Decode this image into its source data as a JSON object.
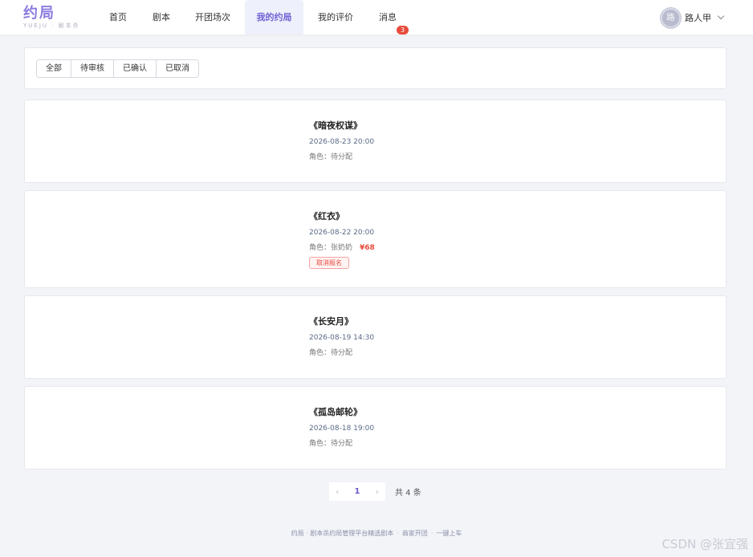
{
  "brand": {
    "name": "约局",
    "sub": "YUEJU · 剧本杀"
  },
  "nav": [
    {
      "label": "首页"
    },
    {
      "label": "剧本"
    },
    {
      "label": "开团场次"
    },
    {
      "label": "我的约局",
      "active": true
    },
    {
      "label": "我的评价"
    },
    {
      "label": "消息",
      "badge": "3"
    }
  ],
  "user": {
    "avatar_char": "路",
    "name": "路人甲"
  },
  "filters": [
    "全部",
    "待审核",
    "已确认",
    "已取消"
  ],
  "bookings": [
    {
      "title": "《暗夜权谋》",
      "time": "2026-08-23 20:00",
      "role": "角色：待分配"
    },
    {
      "title": "《红衣》",
      "time": "2026-08-22 20:00",
      "role": "角色：张奶奶",
      "price": "¥68",
      "action": "取消报名"
    },
    {
      "title": "《长安月》",
      "time": "2026-08-19 14:30",
      "role": "角色：待分配"
    },
    {
      "title": "《孤岛邮轮》",
      "time": "2026-08-18 19:00",
      "role": "角色：待分配"
    }
  ],
  "pagination": {
    "prev_icon": "chevron-left-icon",
    "current": "1",
    "next_icon": "chevron-right-icon",
    "total": "共 4 条"
  },
  "footer": {
    "part1": "约局 · 剧本杀约局管理平台精选剧本",
    "part2": "商家开团",
    "part3": "一键上车"
  },
  "watermark": "CSDN @张宜强",
  "colors": {
    "accent": "#7262d6",
    "danger": "#e74c3c",
    "background": "#f3f4f8"
  }
}
